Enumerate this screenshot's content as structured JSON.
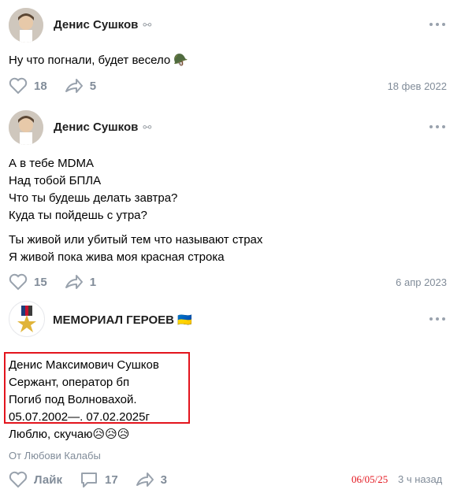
{
  "posts": [
    {
      "author": "Денис Сушков",
      "author_icon": "handcuffs-icon",
      "text": "Ну что погнали, будет весело 🪖",
      "likes": "18",
      "shares": "5",
      "date": "18 фев 2022"
    },
    {
      "author": "Денис Сушков",
      "author_icon": "handcuffs-icon",
      "lines": [
        "А в тебе MDMA",
        "Над тобой БПЛА",
        "Что ты будешь делать завтра?",
        "Куда ты пойдешь с утра?",
        "Ты живой или убитый тем что называют страх",
        "Я живой пока жива моя красная строка"
      ],
      "likes": "15",
      "shares": "1",
      "date": "6 апр 2023"
    },
    {
      "author": "МЕМОРИАЛ ГЕРОЕВ 🇺🇦",
      "lines": [
        "Денис Максимович Сушков",
        "Сержант, оператор бп",
        "Погиб под Волновахой.",
        "05.07.2002—. 07.02.2025г",
        "Люблю, скучаю😥😥😥"
      ],
      "from": "От Любови Калабы",
      "like_label": "Лайк",
      "comments": "17",
      "shares": "3",
      "stamp": "06/05/25",
      "ago": "3 ч назад"
    }
  ],
  "colors": {
    "accent_red": "#e3141d",
    "muted": "#818c99"
  }
}
